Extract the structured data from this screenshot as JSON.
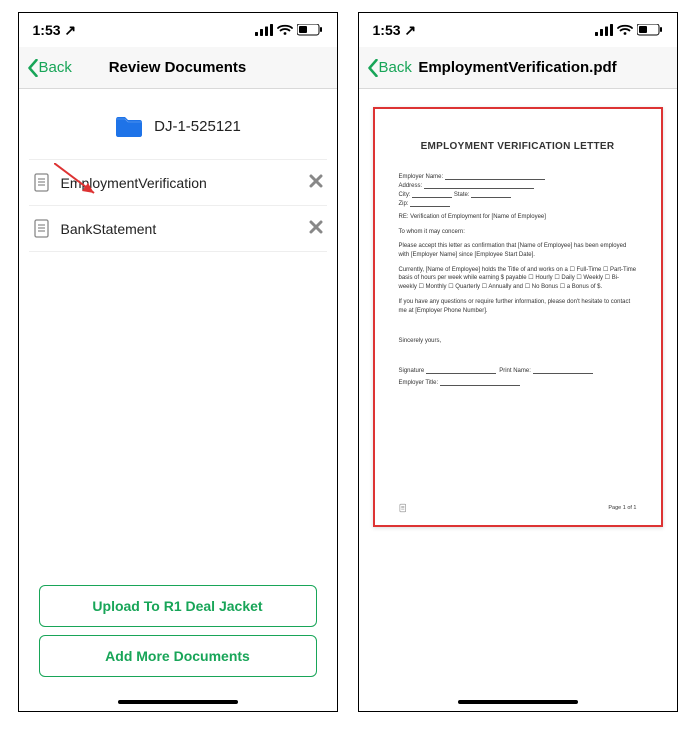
{
  "status": {
    "time": "1:53",
    "location_glyph": "↗"
  },
  "left": {
    "back": "Back",
    "title": "Review Documents",
    "folder_name": "DJ-1-525121",
    "docs": [
      {
        "name": "EmploymentVerification"
      },
      {
        "name": "BankStatement"
      }
    ],
    "btn_upload": "Upload To R1 Deal Jacket",
    "btn_add": "Add More Documents"
  },
  "right": {
    "back": "Back",
    "title": "EmploymentVerification.pdf",
    "preview": {
      "heading": "EMPLOYMENT VERIFICATION LETTER",
      "employer_name_label": "Employer Name:",
      "address_label": "Address:",
      "city_label": "City:",
      "state_label": "State:",
      "zip_label": "Zip:",
      "re_prefix": "RE: Verification of Employment for",
      "re_suffix": "[Name of Employee]",
      "to_whom": "To whom it may concern:",
      "p1_a": "Please accept this letter as confirmation that",
      "p1_b": "[Name of Employee] has been employed with",
      "p1_c": "[Employer Name] since",
      "p1_d": "[Employee Start Date].",
      "p2_a": "Currently,",
      "p2_b": "[Name of Employee] holds the Title of",
      "p2_c": "and works on a ☐ Full-Time ☐ Part-Time basis of",
      "p2_d": "hours per week while earning $",
      "p2_e": "payable ☐ Hourly ☐ Daily ☐ Weekly ☐ Bi-weekly ☐ Monthly ☐ Quarterly ☐ Annually and ☐ No Bonus ☐ a Bonus of $",
      "p3_a": "If you have any questions or require further information, please don't hesitate to contact me at",
      "p3_b": "[Employer Phone Number].",
      "sincerely": "Sincerely yours,",
      "sig_label": "Signature",
      "print_label": "Print Name:",
      "emp_title_label": "Employer Title:",
      "page_footer": "Page 1 of 1"
    }
  }
}
